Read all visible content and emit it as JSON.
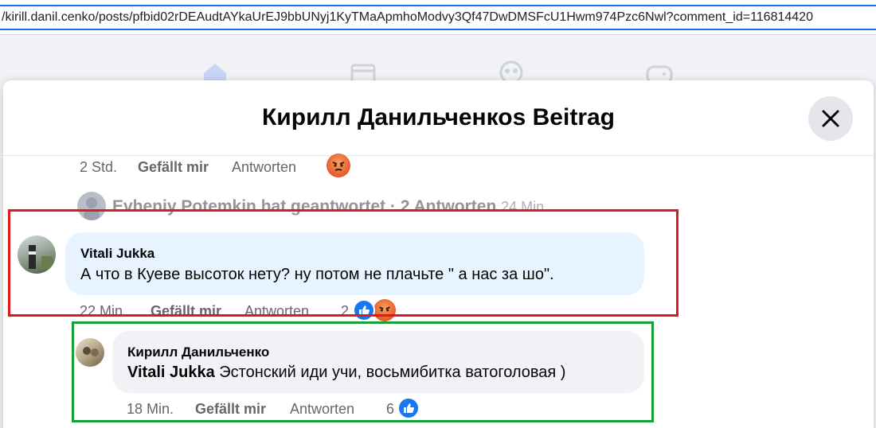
{
  "browser": {
    "url": "/kirill.danil.cenko/posts/pfbid02rDEAudtAYkaUrEJ9bbUNyj1KyTMaApmhoModvy3Qf47DwDMSFcU1Hwm974Pzc6Nwl?comment_id=116814420"
  },
  "modal": {
    "title": "Кирилл Данильченкоs Beitrag",
    "close_icon": "close-icon"
  },
  "top_comment_footer": {
    "time": "2 Std.",
    "like_label": "Gefällt mir",
    "reply_label": "Antworten",
    "reaction_icon": "angry-reaction-icon"
  },
  "replies_summary": {
    "text": "Evheniy Potemkin hat geantwortet · 2 Antworten",
    "time": "24 Min."
  },
  "comment": {
    "author": "Vitali Jukka",
    "text": "А что в Куеве высоток нету? ну потом не плачьте \" а нас за шо\".",
    "time": "22 Min.",
    "like_label": "Gefällt mir",
    "reply_label": "Antworten",
    "reaction_count": "2",
    "reaction_icons": [
      "like-reaction-icon",
      "angry-reaction-icon"
    ]
  },
  "reply": {
    "author": "Кирилл Данильченко",
    "mention": "Vitali Jukka",
    "text": "Эстонский иди учи, восьмибитка ватоголовая )",
    "time": "18 Min.",
    "like_label": "Gefällt mir",
    "reply_label": "Antworten",
    "reaction_count": "6",
    "reaction_icon": "like-reaction-icon"
  },
  "colors": {
    "highlight_red": "#e0191f",
    "highlight_green": "#1aa038",
    "facebook_blue": "#1877f2",
    "comment_bubble": "#e7f3ff",
    "reply_bubble": "#f0f2f5"
  }
}
